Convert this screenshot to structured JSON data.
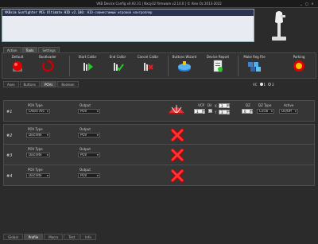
{
  "window": {
    "title": "VKB Device Config v0.92.31 | Nxzy32 firmware v2.10.0 | © Alex Oz 2013-2022",
    "controls": [
      "_",
      "□",
      "×"
    ]
  },
  "banner": {
    "device": "VKBsim Gunfighter MCG Ultimate HID v2.100",
    "description": ": HID-совместимый игровой контроллер"
  },
  "top_tabs": [
    {
      "label": "Action",
      "active": false
    },
    {
      "label": "Tools",
      "active": true
    },
    {
      "label": "Settings",
      "active": false
    }
  ],
  "ribbon": [
    {
      "label": "Default",
      "icon": "default-red-button-icon"
    },
    {
      "label": "Bootloader",
      "icon": "bootloader-icon"
    },
    {
      "label": "Start Calibr",
      "icon": "start-calibration-icon"
    },
    {
      "label": "End Calibr",
      "icon": "end-calibration-icon"
    },
    {
      "label": "Cancel Calibr",
      "icon": "cancel-calibration-icon"
    },
    {
      "label": "Buttons Wizard",
      "icon": "buttons-wizard-icon"
    },
    {
      "label": "Device Report",
      "icon": "device-report-icon"
    },
    {
      "label": "Make Reg File",
      "icon": "make-reg-file-icon"
    },
    {
      "label": "Parking",
      "icon": "parking-icon"
    }
  ],
  "sub_tabs": [
    {
      "label": "Axes",
      "active": false
    },
    {
      "label": "Buttons",
      "active": false
    },
    {
      "label": "POVs",
      "active": true
    },
    {
      "label": "Boolean",
      "active": false
    }
  ],
  "vc": {
    "label": "VC",
    "options": [
      "1",
      "2"
    ],
    "selected": "1"
  },
  "pov_labels": {
    "pov_type": "POV Type",
    "output": "Output",
    "vcp": "VCP",
    "dir": "Dir",
    "x": "X",
    "y": "Y",
    "dz": "DZ",
    "dz_type": "DZ Type",
    "active": "Active"
  },
  "povs": [
    {
      "num": "#1",
      "type": "LAxes Aro",
      "output": "POV",
      "enabled": true
    },
    {
      "num": "#2",
      "type": "Discrete",
      "output": "POV",
      "enabled": false
    },
    {
      "num": "#3",
      "type": "Discrete",
      "output": "POV",
      "enabled": false
    },
    {
      "num": "#4",
      "type": "Discrete",
      "output": "POV",
      "enabled": false
    }
  ],
  "pov1_settings": {
    "vcp": "1",
    "dir": "✓",
    "x": "3",
    "y": "3",
    "dz": "0",
    "dz_type": "Circle",
    "active": "On/Off"
  },
  "bottom_tabs": [
    {
      "label": "Global",
      "active": false
    },
    {
      "label": "Profile",
      "active": true
    },
    {
      "label": "Macro",
      "active": false
    },
    {
      "label": "Test",
      "active": false
    },
    {
      "label": "Info",
      "active": false
    }
  ]
}
